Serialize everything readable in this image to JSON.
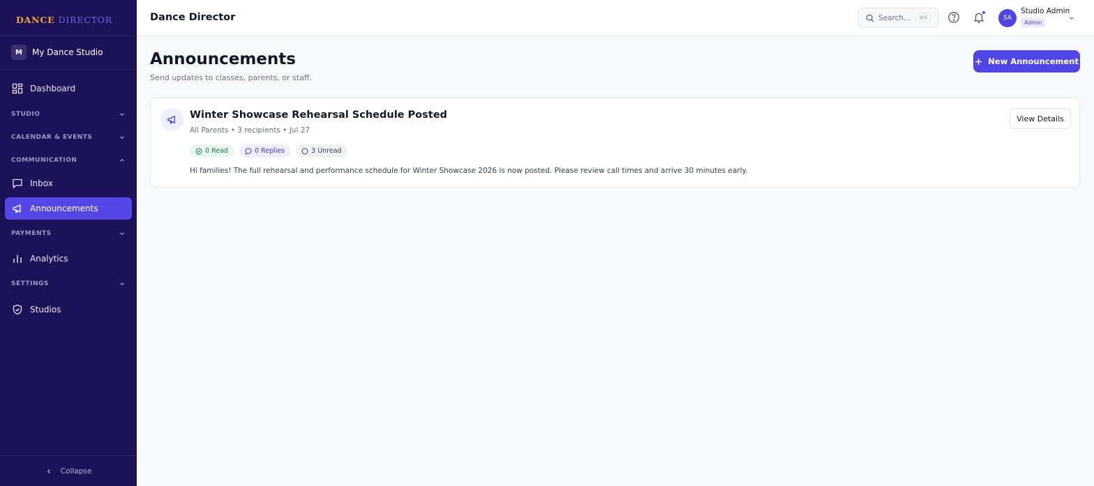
{
  "brand": {
    "word1": "DANCE",
    "word2": "DIRECTOR"
  },
  "studio": {
    "initial": "M",
    "name": "My Dance Studio"
  },
  "sidebar": {
    "dashboard": "Dashboard",
    "sections": {
      "studio": "STUDIO",
      "calendar": "CALENDAR & EVENTS",
      "communication": "COMMUNICATION",
      "payments": "PAYMENTS",
      "settings": "SETTINGS"
    },
    "inbox": "Inbox",
    "announcements": "Announcements",
    "analytics": "Analytics",
    "studios": "Studios",
    "collapse": "Collapse"
  },
  "topbar": {
    "title": "Dance Director",
    "search_placeholder": "Search...",
    "search_shortcut": "⌘K",
    "user_initials": "SA",
    "user_name": "Studio Admin",
    "user_role": "Admin"
  },
  "page": {
    "title": "Announcements",
    "subtitle": "Send updates to classes, parents, or staff.",
    "new_button": "New Announcement"
  },
  "announcements": [
    {
      "title": "Winter Showcase Rehearsal Schedule Posted",
      "meta": "All Parents • 3 recipients • Jul 27",
      "read": "0 Read",
      "replies": "0 Replies",
      "unread": "3 Unread",
      "body": "Hi families! The full rehearsal and performance schedule for Winter Showcase 2026 is now posted. Please review call times and arrive 30 minutes early.",
      "action": "View Details"
    }
  ],
  "colors": {
    "sidebar_bg": "#1c1258",
    "accent": "#4f46e5",
    "brand_gold": "#f4a23a",
    "brand_purple": "#6e63e6"
  }
}
